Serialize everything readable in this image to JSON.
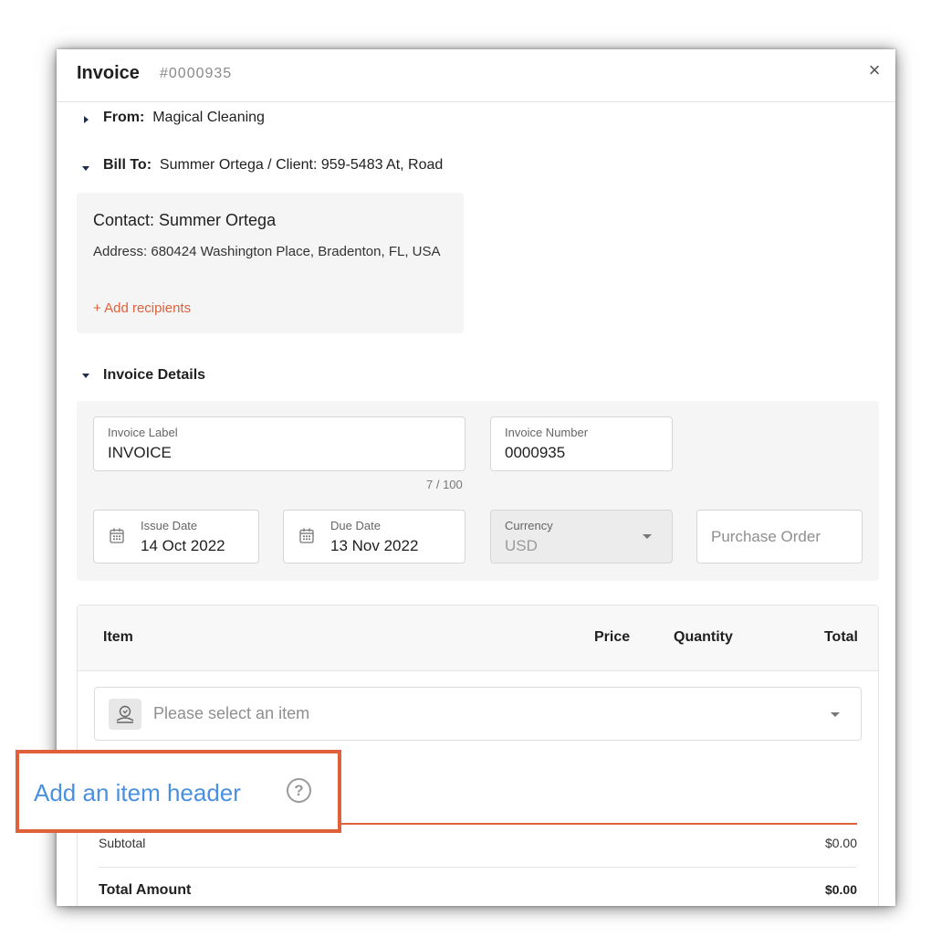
{
  "invoice": {
    "title": "Invoice",
    "number": "#0000935",
    "close": "×"
  },
  "from": {
    "label": "From:",
    "value": "Magical Cleaning"
  },
  "bill_to": {
    "label": "Bill To:",
    "name": "Summer Ortega",
    "extra": " / Client: 959-5483 At, Road"
  },
  "contact": {
    "name": "Contact: Summer Ortega",
    "address": "Address: 680424 Washington Place, Bradenton, FL, USA",
    "add_recipients": "+ Add recipients"
  },
  "details": {
    "title": "Invoice Details",
    "invoice_label": {
      "label": "Invoice Label",
      "value": "INVOICE",
      "counter": "7 / 100"
    },
    "invoice_number": {
      "label": "Invoice Number",
      "value": "0000935"
    },
    "issue_date": {
      "label": "Issue Date",
      "value": "14 Oct 2022"
    },
    "due_date": {
      "label": "Due Date",
      "value": "13 Nov 2022"
    },
    "currency": {
      "label": "Currency",
      "value": "USD"
    },
    "purchase_order": {
      "placeholder": "Purchase Order"
    }
  },
  "items": {
    "columns": {
      "item": "Item",
      "price": "Price",
      "quantity": "Quantity",
      "total": "Total"
    },
    "select_placeholder": "Please select an item"
  },
  "totals": {
    "subtotal_label": "Subtotal",
    "subtotal_value": "$0.00",
    "total_label": "Total Amount",
    "total_value": "$0.00"
  },
  "callout": {
    "text": "Add an item header",
    "help": "?"
  },
  "colors": {
    "accent": "#e0603a",
    "link": "#4a8fe0"
  },
  "icons": [
    "calendar-icon",
    "item-icon",
    "help-icon",
    "close-icon",
    "caret-icon"
  ]
}
